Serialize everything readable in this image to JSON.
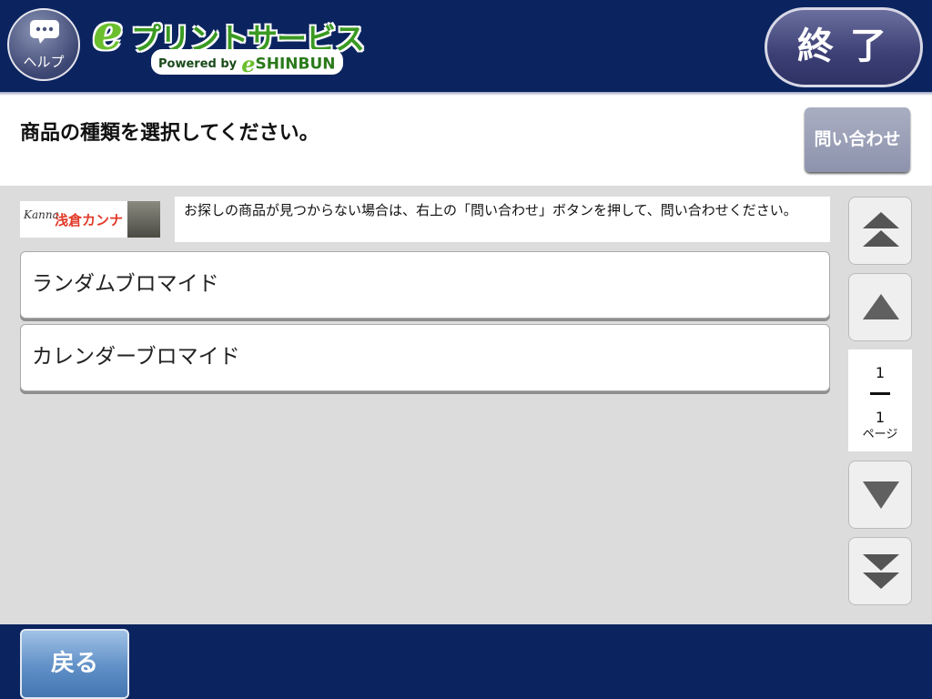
{
  "header": {
    "help_label": "ヘルプ",
    "logo_e": "e",
    "logo_title": "プリントサービス",
    "logo_powered": "Powered by",
    "logo_e2": "e",
    "logo_shinbun": "SHINBUN",
    "exit_label": "終了",
    "bg_color": "#0b2460"
  },
  "title_bar": {
    "instruction": "商品の種類を選択してください。",
    "inquiry_label": "問い合わせ"
  },
  "banner": {
    "signature": "Kanna",
    "name": "浅倉カンナ"
  },
  "notice": "お探しの商品が見つからない場合は、右上の「問い合わせ」ボタンを押して、問い合わせください。",
  "items": [
    {
      "label": "ランダムブロマイド"
    },
    {
      "label": "カレンダーブロマイド"
    }
  ],
  "pager": {
    "current": "1",
    "total": "1",
    "unit": "ページ"
  },
  "footer": {
    "back_label": "戻る"
  }
}
